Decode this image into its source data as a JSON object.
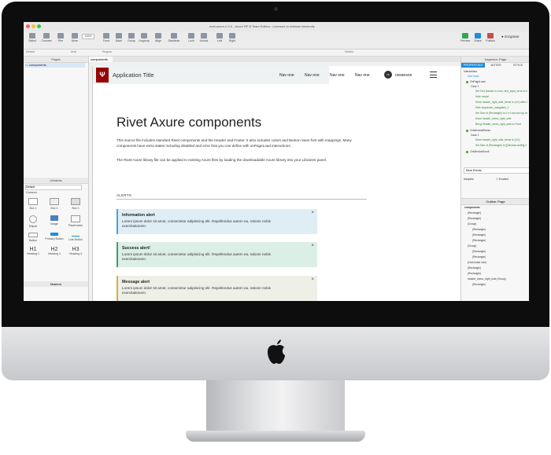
{
  "window": {
    "title": "rivet-axure-0.2.0 - Axure RP 8 Team Edition : Licensed to Indiana University",
    "user": "imcgrane"
  },
  "toolbar": {
    "items": [
      "Select",
      "Connect",
      "Pen",
      "More",
      "Zoom",
      "Front",
      "Back",
      "Group",
      "Ungroup",
      "Align",
      "Distribute",
      "Lock",
      "Unlock",
      "Left",
      "Right",
      "Preview",
      "Share",
      "Publish"
    ],
    "zoom": "100%"
  },
  "style_bar": {
    "style": "Default",
    "font": "Arial",
    "weight": "Regular",
    "hidden": "Hidden"
  },
  "pages_panel": {
    "title": "Pages",
    "items": [
      "components"
    ]
  },
  "libraries_panel": {
    "title": "Libraries",
    "library": "Default",
    "group": "Common",
    "widgets": [
      "Box 1",
      "Box 2",
      "Box 3",
      "Ellipse",
      "Image",
      "Placeholder",
      "Button",
      "Primary Button",
      "Link Button",
      "Heading 1",
      "Heading 2",
      "Heading 3"
    ],
    "headings": [
      "H1",
      "H2",
      "H3"
    ],
    "masters_title": "Masters"
  },
  "canvas": {
    "tab": "components",
    "header": {
      "app_title": "Application Title",
      "logo": "Ψ",
      "nav": [
        "Nav one",
        "Nav one",
        "Nav one",
        "Nav one"
      ],
      "avatar_initials": "rs",
      "username": "rswanson"
    },
    "heading": "Rivet Axure components",
    "para1": "This source file includes standard Rivet components and the Header and Footer. It also includes colors and Benton Sans font with mappings. Many components have extra states including disabled and error that you can define with onPageLoad interactions.",
    "para2": "The Rivet Axure library file can be applied to existing Axure files by loading the downloadable Axure library into your Libraries panel.",
    "section": "ALERTS",
    "alerts": [
      {
        "title": "Information alert",
        "body": "Lorem ipsum dolor sit amet, consectetur adipisicing elit. Repellendus autem ea, ratione nobis exercitationem.",
        "close": "×"
      },
      {
        "title": "Success alert!",
        "body": "Lorem ipsum dolor sit amet, consectetur adipisicing elit. Repellendus autem ea, ratione nobis exercitationem.",
        "close": "×"
      },
      {
        "title": "Message alert",
        "body": "Lorem ipsum dolor sit amet, consectetur adipisicing elit. Repellendus autem ea, ratione nobis exercitationem.",
        "close": "×"
      }
    ]
  },
  "inspector": {
    "title": "Inspector: Page",
    "tabs": [
      "PROPERTIES",
      "NOTES",
      "STYLE"
    ],
    "interactions": "Interactions",
    "add_case": "Add Case",
    "tree": [
      "OnPageLoad",
      "Case 1",
      "Set Text (border to error, text_input_error to error)",
      "Hide modal",
      "Move header_right_side_items to (0,0) after 0 ms",
      "Hide dropdown_navigation_1",
      "Set Size of (Rectangle) to 0 x 0 anchor top left",
      "Move header_menu_right_side",
      "Bring Header_menu_right_side to Front",
      "OnWindowResize",
      "Case 1",
      "Move header_right_side_items to (0,0)",
      "Set Size of (Rectangle) to [[Window.width]] x 72 anchor top left",
      "OnWindowScroll"
    ],
    "more_events": "More Events",
    "adaptive": "Adaptive",
    "enabled": "Enabled",
    "colors": {
      "tab_active": "#1c8dd9",
      "link": "#1c8dd9",
      "leaf": "#6aa84f"
    }
  },
  "outline": {
    "title": "Outline: Page",
    "items": [
      "components",
      "(Rectangle)",
      "(Rectangle)",
      "(Group)",
      "(Rectangle)",
      "(Rectangle)",
      "(Rectangle)",
      "(Group)",
      "(Rectangle)",
      "(Rectangle)",
      "(Horizontal Line)",
      "(Rectangle)",
      "(Rectangle)",
      "header_menu_right_side (Group)",
      "(Rectangle)"
    ]
  },
  "colors": {
    "iu_crimson": "#990000",
    "info": "#dfeef5",
    "info_border": "#4aa3d6",
    "success": "#dcefe6",
    "success_border": "#3a9e73",
    "message": "#eef0e8",
    "message_border": "#e0a93a"
  }
}
